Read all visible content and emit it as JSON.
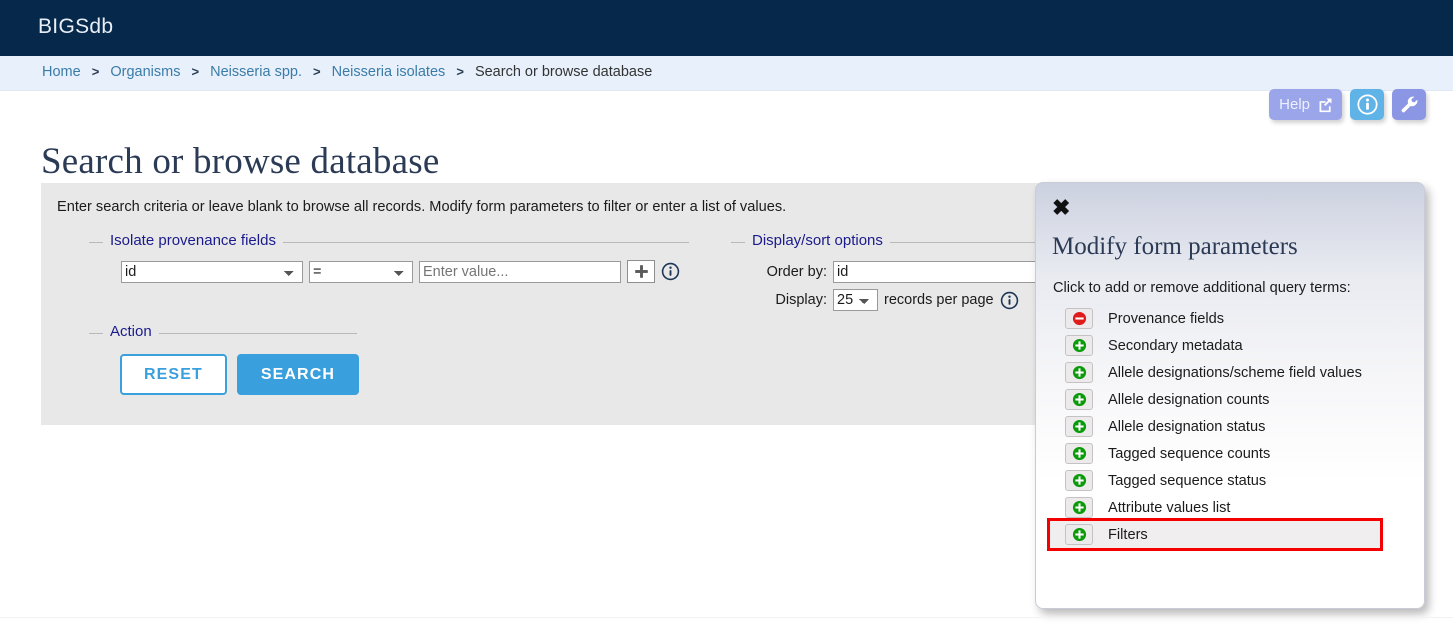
{
  "topbar": {
    "brand": "BIGSdb"
  },
  "breadcrumb": {
    "items": [
      {
        "label": "Home",
        "link": true
      },
      {
        "label": "Organisms",
        "link": true
      },
      {
        "label": "Neisseria spp.",
        "link": true
      },
      {
        "label": "Neisseria isolates",
        "link": true
      },
      {
        "label": "Search or browse database",
        "link": false
      }
    ],
    "separator": ">"
  },
  "page": {
    "title": "Search or browse database"
  },
  "toolbuttons": {
    "help_label": "Help",
    "help_icon": "external-link-icon",
    "info_icon": "info-icon",
    "tools_icon": "wrench-icon",
    "help_color": "#9aa5ea",
    "info_color": "#5fb3e6",
    "tools_color": "#8b96e4"
  },
  "form": {
    "intro": "Enter search criteria or leave blank to browse all records. Modify form parameters to filter or enter a list of values.",
    "provenance": {
      "legend": "Isolate provenance fields",
      "field_value": "id",
      "operator_value": "=",
      "value_placeholder": "Enter value...",
      "value_current": "",
      "add_icon": "plus-icon",
      "info_icon": "info-icon"
    },
    "display": {
      "legend": "Display/sort options",
      "order_by_label": "Order by:",
      "order_by_value": "id",
      "display_label": "Display:",
      "display_value": "25",
      "records_suffix": "records per page",
      "info_icon": "info-icon"
    },
    "action": {
      "legend": "Action",
      "reset_label": "RESET",
      "search_label": "SEARCH",
      "reset_color": "#3aa0dd",
      "search_color": "#3aa0dd"
    }
  },
  "modal": {
    "close_icon": "close-icon",
    "close_glyph": "✖",
    "title": "Modify form parameters",
    "subtitle": "Click to add or remove additional query terms:",
    "terms": [
      {
        "label": "Provenance fields",
        "state": "remove",
        "icon": "minus-circle-icon",
        "highlighted": false
      },
      {
        "label": "Secondary metadata",
        "state": "add",
        "icon": "plus-circle-icon",
        "highlighted": false
      },
      {
        "label": "Allele designations/scheme field values",
        "state": "add",
        "icon": "plus-circle-icon",
        "highlighted": false
      },
      {
        "label": "Allele designation counts",
        "state": "add",
        "icon": "plus-circle-icon",
        "highlighted": false
      },
      {
        "label": "Allele designation status",
        "state": "add",
        "icon": "plus-circle-icon",
        "highlighted": false
      },
      {
        "label": "Tagged sequence counts",
        "state": "add",
        "icon": "plus-circle-icon",
        "highlighted": false
      },
      {
        "label": "Tagged sequence status",
        "state": "add",
        "icon": "plus-circle-icon",
        "highlighted": false
      },
      {
        "label": "Attribute values list",
        "state": "add",
        "icon": "plus-circle-icon",
        "highlighted": false
      },
      {
        "label": "Filters",
        "state": "add",
        "icon": "plus-circle-icon",
        "highlighted": true
      }
    ],
    "add_color": "#0a9a0a",
    "remove_color": "#e01b1b",
    "highlight_color": "#f40000"
  }
}
